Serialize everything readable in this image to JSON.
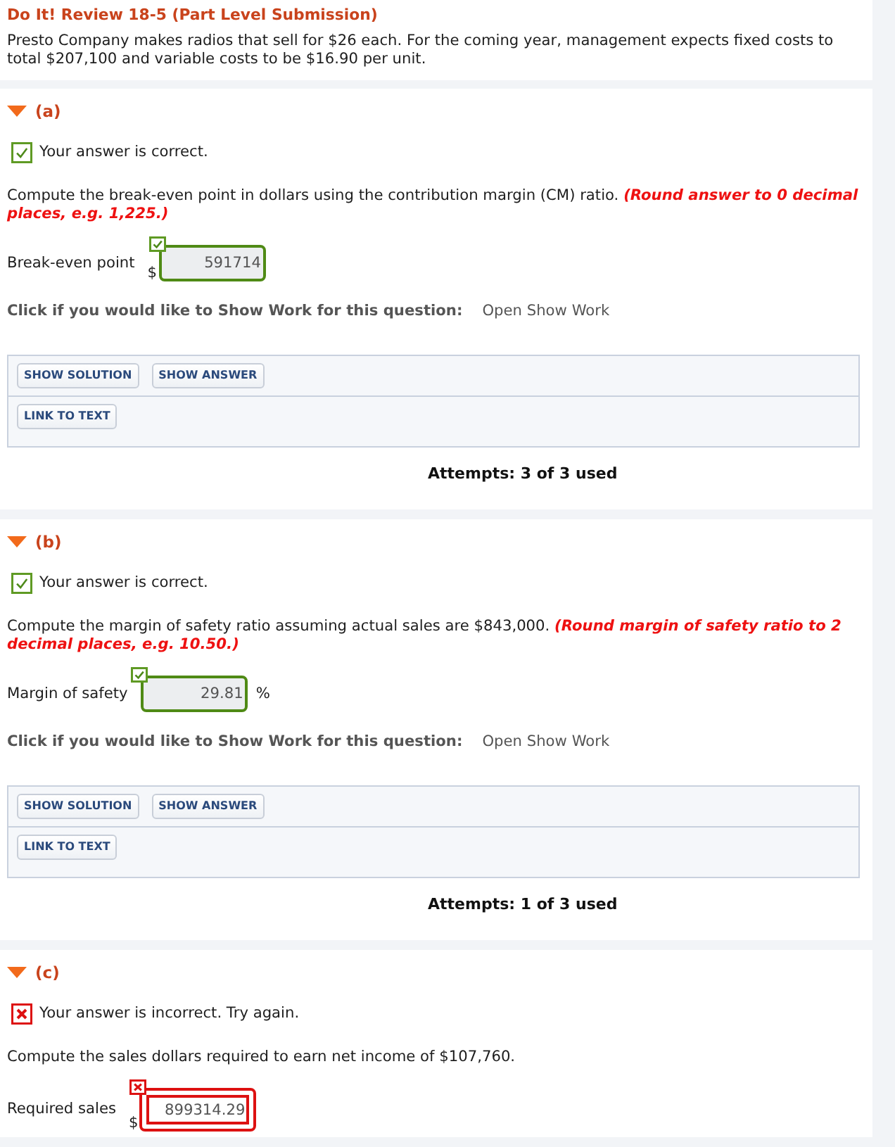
{
  "header": {
    "title": "Do It! Review 18-5 (Part Level Submission)",
    "intro": "Presto Company makes radios that sell for $26 each. For the coming year, management expects fixed costs to total $207,100 and variable costs to be $16.90 per unit."
  },
  "parts": [
    {
      "label": "(a)",
      "expanded": true,
      "result": {
        "correct": true,
        "message": "Your answer is correct."
      },
      "question": "Compute the break-even point in dollars using the contribution margin (CM) ratio. **(Round answer to 0 decimal places, e.g. 1,225.)**",
      "answer": {
        "label": "Break-even point",
        "prefix": "$",
        "value": "591714",
        "correct": true
      },
      "show_work": {
        "prompt": "Click if you would like to Show Work for this question:",
        "link": "Open Show Work"
      },
      "tool_rows": [
        [
          "SHOW SOLUTION",
          "SHOW ANSWER"
        ],
        [
          "LINK TO TEXT"
        ]
      ],
      "attempts": "Attempts: 3 of 3 used"
    },
    {
      "label": "(b)",
      "expanded": true,
      "result": {
        "correct": true,
        "message": "Your answer is correct."
      },
      "question": "Compute the margin of safety ratio assuming actual sales are $843,000. **(Round margin of safety ratio to 2 decimal places, e.g. 10.50.)**",
      "answer": {
        "label": "Margin of safety",
        "value": "29.81",
        "suffix": "%",
        "correct": true
      },
      "show_work": {
        "prompt": "Click if you would like to Show Work for this question:",
        "link": "Open Show Work"
      },
      "tool_rows": [
        [
          "SHOW SOLUTION",
          "SHOW ANSWER"
        ],
        [
          "LINK TO TEXT"
        ]
      ],
      "attempts": "Attempts: 1 of 3 used"
    },
    {
      "label": "(c)",
      "expanded": true,
      "result": {
        "correct": false,
        "message": "Your answer is incorrect. Try again."
      },
      "question": "Compute the sales dollars required to earn net income of $107,760.",
      "answer": {
        "label": "Required sales",
        "prefix": "$",
        "value": "899314.29",
        "correct": false
      }
    }
  ]
}
